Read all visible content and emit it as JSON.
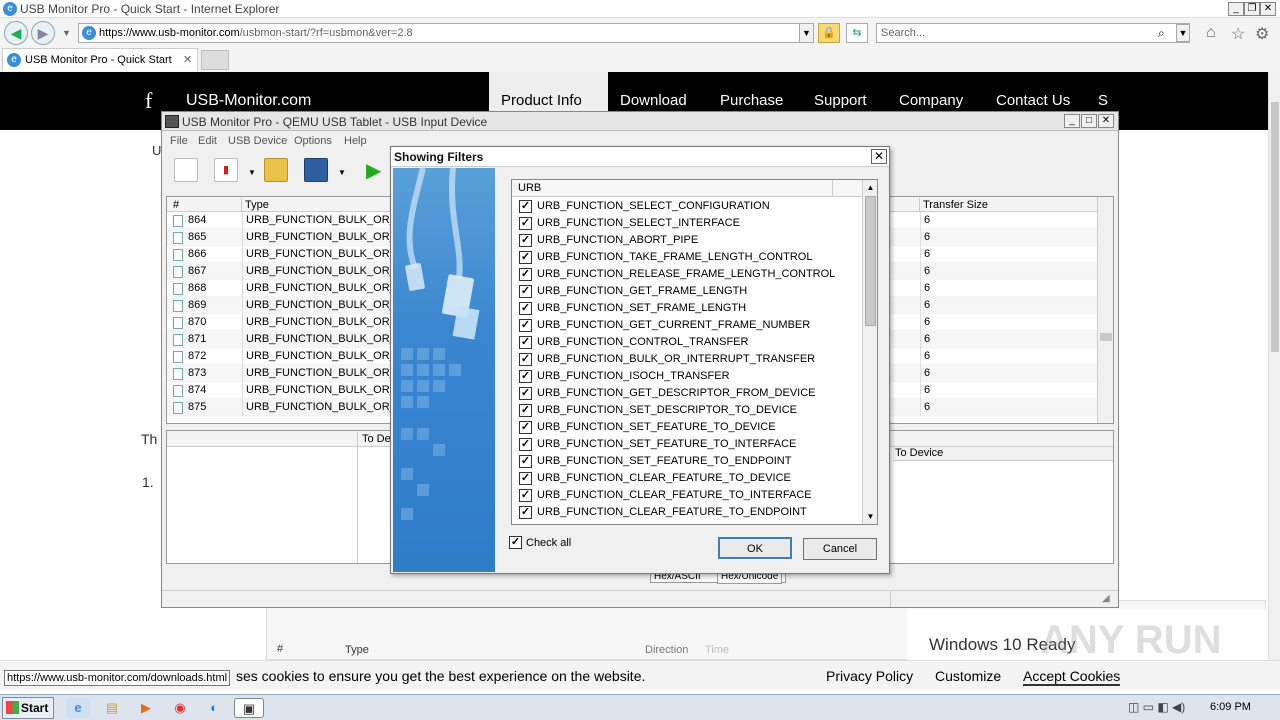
{
  "ie": {
    "title": "USB Monitor Pro - Quick Start - Internet Explorer",
    "url_main": "https://www.usb-monitor.com",
    "url_rest": "/usbmon-start/?rf=usbmon&ver=2.8",
    "search_placeholder": "Search...",
    "tab_label": "USB Monitor Pro - Quick Start"
  },
  "site": {
    "logo": "USB-Monitor.com",
    "social": "f",
    "nav": [
      "Product Info",
      "Download",
      "Purchase",
      "Support",
      "Company",
      "Contact Us",
      "S"
    ],
    "left_letter": "U",
    "para_start": "Th",
    "list_num": "1.",
    "cookie_text": "ses cookies to ensure you get the best experience on the website.",
    "cookie_links": [
      "Privacy Policy",
      "Customize",
      "Accept Cookies"
    ],
    "bg_ready": "Windows 10 Ready",
    "bg_type": "Type",
    "bg_hash": "#",
    "bg_direction": "Direction",
    "bg_time": "Time",
    "status_url": "https://www.usb-monitor.com/downloads.html"
  },
  "usb": {
    "title": "USB Monitor Pro - QEMU USB Tablet - USB Input Device",
    "menu": [
      "File",
      "Edit",
      "USB Device",
      "Options",
      "Help"
    ],
    "headers": {
      "num": "#",
      "type": "Type",
      "transfer": "Transfer Size"
    },
    "rows": [
      {
        "num": "864",
        "type": "URB_FUNCTION_BULK_OR_INT",
        "size": "6"
      },
      {
        "num": "865",
        "type": "URB_FUNCTION_BULK_OR_INT",
        "size": "6"
      },
      {
        "num": "866",
        "type": "URB_FUNCTION_BULK_OR_INT",
        "size": "6"
      },
      {
        "num": "867",
        "type": "URB_FUNCTION_BULK_OR_INT",
        "size": "6"
      },
      {
        "num": "868",
        "type": "URB_FUNCTION_BULK_OR_INT",
        "size": "6"
      },
      {
        "num": "869",
        "type": "URB_FUNCTION_BULK_OR_INT",
        "size": "6"
      },
      {
        "num": "870",
        "type": "URB_FUNCTION_BULK_OR_INT",
        "size": "6"
      },
      {
        "num": "871",
        "type": "URB_FUNCTION_BULK_OR_INT",
        "size": "6"
      },
      {
        "num": "872",
        "type": "URB_FUNCTION_BULK_OR_INT",
        "size": "6"
      },
      {
        "num": "873",
        "type": "URB_FUNCTION_BULK_OR_INT",
        "size": "6"
      },
      {
        "num": "874",
        "type": "URB_FUNCTION_BULK_OR_INT",
        "size": "6"
      },
      {
        "num": "875",
        "type": "URB_FUNCTION_BULK_OR_INT",
        "size": "6"
      }
    ],
    "lower_headers": {
      "to_device_a": "To De",
      "to_device_b": "To Device"
    },
    "tabs": [
      "Hex/ASCII",
      "Hex/Unicode"
    ]
  },
  "dialog": {
    "title": "Showing Filters",
    "column": "URB",
    "items": [
      "URB_FUNCTION_SELECT_CONFIGURATION",
      "URB_FUNCTION_SELECT_INTERFACE",
      "URB_FUNCTION_ABORT_PIPE",
      "URB_FUNCTION_TAKE_FRAME_LENGTH_CONTROL",
      "URB_FUNCTION_RELEASE_FRAME_LENGTH_CONTROL",
      "URB_FUNCTION_GET_FRAME_LENGTH",
      "URB_FUNCTION_SET_FRAME_LENGTH",
      "URB_FUNCTION_GET_CURRENT_FRAME_NUMBER",
      "URB_FUNCTION_CONTROL_TRANSFER",
      "URB_FUNCTION_BULK_OR_INTERRUPT_TRANSFER",
      "URB_FUNCTION_ISOCH_TRANSFER",
      "URB_FUNCTION_GET_DESCRIPTOR_FROM_DEVICE",
      "URB_FUNCTION_SET_DESCRIPTOR_TO_DEVICE",
      "URB_FUNCTION_SET_FEATURE_TO_DEVICE",
      "URB_FUNCTION_SET_FEATURE_TO_INTERFACE",
      "URB_FUNCTION_SET_FEATURE_TO_ENDPOINT",
      "URB_FUNCTION_CLEAR_FEATURE_TO_DEVICE",
      "URB_FUNCTION_CLEAR_FEATURE_TO_INTERFACE",
      "URB_FUNCTION_CLEAR_FEATURE_TO_ENDPOINT"
    ],
    "check_all": "Check all",
    "ok": "OK",
    "cancel": "Cancel"
  },
  "taskbar": {
    "start": "Start",
    "time": "6:09 PM"
  },
  "watermark": "ANY RUN",
  "icons": [
    "ie-logo-icon",
    "back-icon",
    "forward-icon",
    "lock-icon",
    "refresh-icon",
    "search-icon",
    "home-icon",
    "star-icon",
    "gear-icon",
    "checkbox-icon",
    "new-file-icon",
    "usb-device-icon",
    "folder-open-icon",
    "save-icon",
    "play-icon",
    "document-icon"
  ]
}
